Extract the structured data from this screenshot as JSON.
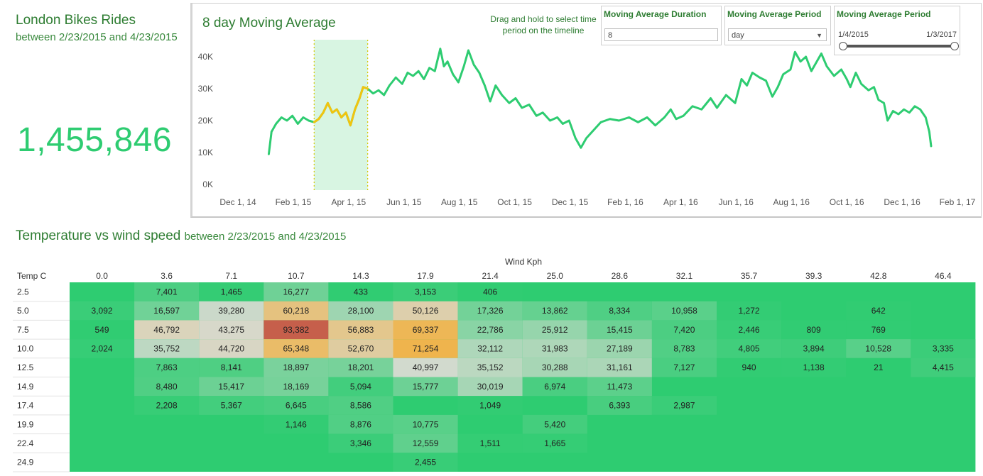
{
  "header": {
    "title": "London Bikes Rides",
    "subtitle": "between 2/23/2015 and 4/23/2015"
  },
  "total": "1,455,846",
  "controls": {
    "hint": "Drag and hold to select time period on the timeline",
    "duration": {
      "label": "Moving Average Duration",
      "value": "8"
    },
    "period": {
      "label": "Moving Average Period",
      "value": "day"
    },
    "range": {
      "label": "Moving Average Period",
      "from": "1/4/2015",
      "to": "1/3/2017"
    }
  },
  "colors": {
    "accent": "#2ecc71",
    "highlight": "#f1c40f",
    "title": "#2e7d32",
    "selection": "#d8f5e2"
  },
  "chart_data": [
    {
      "type": "line",
      "title": "8 day Moving Average",
      "ylabel": "",
      "ylim": [
        0,
        45000
      ],
      "yticks": [
        {
          "value": 0,
          "label": "0K"
        },
        {
          "value": 10000,
          "label": "10K"
        },
        {
          "value": 20000,
          "label": "20K"
        },
        {
          "value": 30000,
          "label": "30K"
        },
        {
          "value": 40000,
          "label": "40K"
        }
      ],
      "xticks": [
        "Dec 1, 14",
        "Feb 1, 15",
        "Apr 1, 15",
        "Jun 1, 15",
        "Aug 1, 15",
        "Oct 1, 15",
        "Dec 1, 15",
        "Feb 1, 16",
        "Apr 1, 16",
        "Jun 1, 16",
        "Aug 1, 16",
        "Oct 1, 16",
        "Dec 1, 16",
        "Feb 1, 17"
      ],
      "x_start": "2014-12-01",
      "x_end": "2017-02-01",
      "selection": [
        "2015-02-23",
        "2015-04-23"
      ],
      "series": [
        {
          "points": [
            [
              "2015-01-04",
              9500
            ],
            [
              "2015-01-07",
              16500
            ],
            [
              "2015-01-12",
              19000
            ],
            [
              "2015-01-18",
              21000
            ],
            [
              "2015-01-24",
              20000
            ],
            [
              "2015-01-30",
              21500
            ],
            [
              "2015-02-05",
              19000
            ],
            [
              "2015-02-11",
              21000
            ],
            [
              "2015-02-17",
              20000
            ],
            [
              "2015-02-23",
              19500
            ],
            [
              "2015-02-28",
              20500
            ],
            [
              "2015-03-05",
              22500
            ],
            [
              "2015-03-10",
              25500
            ],
            [
              "2015-03-15",
              22500
            ],
            [
              "2015-03-20",
              23500
            ],
            [
              "2015-03-25",
              21000
            ],
            [
              "2015-03-30",
              22500
            ],
            [
              "2015-04-04",
              18500
            ],
            [
              "2015-04-09",
              23500
            ],
            [
              "2015-04-14",
              27000
            ],
            [
              "2015-04-18",
              30500
            ],
            [
              "2015-04-23",
              30000
            ],
            [
              "2015-04-29",
              28500
            ],
            [
              "2015-05-05",
              29500
            ],
            [
              "2015-05-11",
              28000
            ],
            [
              "2015-05-17",
              31000
            ],
            [
              "2015-05-24",
              33500
            ],
            [
              "2015-05-31",
              31500
            ],
            [
              "2015-06-06",
              35000
            ],
            [
              "2015-06-12",
              34000
            ],
            [
              "2015-06-18",
              35500
            ],
            [
              "2015-06-24",
              33000
            ],
            [
              "2015-06-30",
              36500
            ],
            [
              "2015-07-06",
              35500
            ],
            [
              "2015-07-12",
              42500
            ],
            [
              "2015-07-16",
              37000
            ],
            [
              "2015-07-20",
              38500
            ],
            [
              "2015-07-26",
              34500
            ],
            [
              "2015-08-01",
              32000
            ],
            [
              "2015-08-07",
              37000
            ],
            [
              "2015-08-12",
              42000
            ],
            [
              "2015-08-18",
              37500
            ],
            [
              "2015-08-24",
              35000
            ],
            [
              "2015-08-30",
              31000
            ],
            [
              "2015-09-05",
              26000
            ],
            [
              "2015-09-11",
              31000
            ],
            [
              "2015-09-18",
              28000
            ],
            [
              "2015-09-26",
              25500
            ],
            [
              "2015-10-03",
              27000
            ],
            [
              "2015-10-10",
              24000
            ],
            [
              "2015-10-18",
              25000
            ],
            [
              "2015-10-26",
              21500
            ],
            [
              "2015-11-02",
              22500
            ],
            [
              "2015-11-10",
              20000
            ],
            [
              "2015-11-18",
              21000
            ],
            [
              "2015-11-24",
              19000
            ],
            [
              "2015-12-01",
              20000
            ],
            [
              "2015-12-08",
              14500
            ],
            [
              "2015-12-14",
              11500
            ],
            [
              "2015-12-20",
              14500
            ],
            [
              "2015-12-28",
              17000
            ],
            [
              "2016-01-05",
              19500
            ],
            [
              "2016-01-15",
              20500
            ],
            [
              "2016-01-25",
              20000
            ],
            [
              "2016-02-05",
              21000
            ],
            [
              "2016-02-15",
              19500
            ],
            [
              "2016-02-25",
              21000
            ],
            [
              "2016-03-05",
              18500
            ],
            [
              "2016-03-15",
              21000
            ],
            [
              "2016-03-22",
              23500
            ],
            [
              "2016-03-28",
              20500
            ],
            [
              "2016-04-05",
              21500
            ],
            [
              "2016-04-15",
              24500
            ],
            [
              "2016-04-25",
              23500
            ],
            [
              "2016-05-05",
              27000
            ],
            [
              "2016-05-12",
              24000
            ],
            [
              "2016-05-22",
              28000
            ],
            [
              "2016-06-01",
              25500
            ],
            [
              "2016-06-08",
              33000
            ],
            [
              "2016-06-14",
              31000
            ],
            [
              "2016-06-20",
              35000
            ],
            [
              "2016-06-28",
              33500
            ],
            [
              "2016-07-05",
              32500
            ],
            [
              "2016-07-12",
              27500
            ],
            [
              "2016-07-18",
              30500
            ],
            [
              "2016-07-24",
              34500
            ],
            [
              "2016-08-01",
              36000
            ],
            [
              "2016-08-06",
              41500
            ],
            [
              "2016-08-12",
              38500
            ],
            [
              "2016-08-18",
              40000
            ],
            [
              "2016-08-24",
              35500
            ],
            [
              "2016-08-30",
              38500
            ],
            [
              "2016-09-04",
              41000
            ],
            [
              "2016-09-10",
              37000
            ],
            [
              "2016-09-18",
              34000
            ],
            [
              "2016-09-26",
              36000
            ],
            [
              "2016-10-02",
              33000
            ],
            [
              "2016-10-06",
              30500
            ],
            [
              "2016-10-12",
              35000
            ],
            [
              "2016-10-18",
              31500
            ],
            [
              "2016-10-26",
              29500
            ],
            [
              "2016-11-01",
              30500
            ],
            [
              "2016-11-06",
              26500
            ],
            [
              "2016-11-12",
              25500
            ],
            [
              "2016-11-16",
              20000
            ],
            [
              "2016-11-22",
              23000
            ],
            [
              "2016-11-28",
              22000
            ],
            [
              "2016-12-04",
              23500
            ],
            [
              "2016-12-10",
              22500
            ],
            [
              "2016-12-16",
              24500
            ],
            [
              "2016-12-22",
              23500
            ],
            [
              "2016-12-28",
              21000
            ],
            [
              "2017-01-01",
              16500
            ],
            [
              "2017-01-03",
              12000
            ]
          ]
        }
      ]
    },
    {
      "type": "heatmap",
      "title": "Temperature vs wind speed",
      "subtitle": "between 2/23/2015 and 4/23/2015",
      "xlabel": "Wind Kph",
      "ylabel": "Temp C",
      "x": [
        "0.0",
        "3.6",
        "7.1",
        "10.7",
        "14.3",
        "17.9",
        "21.4",
        "25.0",
        "28.6",
        "32.1",
        "35.7",
        "39.3",
        "42.8",
        "46.4"
      ],
      "y": [
        "2.5",
        "5.0",
        "7.5",
        "10.0",
        "12.5",
        "14.9",
        "17.4",
        "19.9",
        "22.4",
        "24.9"
      ],
      "values": [
        [
          null,
          7401,
          1465,
          16277,
          433,
          3153,
          406,
          null,
          null,
          null,
          null,
          null,
          null,
          null
        ],
        [
          3092,
          16597,
          39280,
          60218,
          28100,
          50126,
          17326,
          13862,
          8334,
          10958,
          1272,
          null,
          642,
          null
        ],
        [
          549,
          46792,
          43275,
          93382,
          56883,
          69337,
          22786,
          25912,
          15415,
          7420,
          2446,
          809,
          769,
          null
        ],
        [
          2024,
          35752,
          44720,
          65348,
          52670,
          71254,
          32112,
          31983,
          27189,
          8783,
          4805,
          3894,
          10528,
          3335
        ],
        [
          null,
          7863,
          8141,
          18897,
          18201,
          40997,
          35152,
          30288,
          31161,
          7127,
          940,
          1138,
          21,
          4415
        ],
        [
          null,
          8480,
          15417,
          18169,
          5094,
          15777,
          30019,
          6974,
          11473,
          null,
          null,
          null,
          null,
          null
        ],
        [
          null,
          2208,
          5367,
          6645,
          8586,
          null,
          1049,
          null,
          6393,
          2987,
          null,
          null,
          null,
          null
        ],
        [
          null,
          null,
          null,
          1146,
          8876,
          10775,
          null,
          5420,
          null,
          null,
          null,
          null,
          null,
          null
        ],
        [
          null,
          null,
          null,
          null,
          3346,
          12559,
          1511,
          1665,
          null,
          null,
          null,
          null,
          null,
          null
        ],
        [
          null,
          null,
          null,
          null,
          null,
          2455,
          null,
          null,
          null,
          null,
          null,
          null,
          null,
          null
        ]
      ]
    }
  ]
}
